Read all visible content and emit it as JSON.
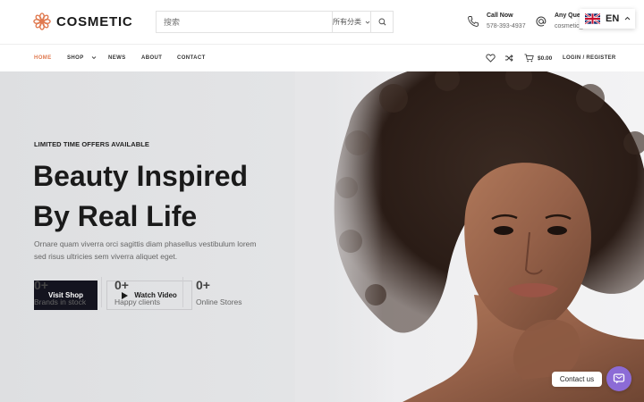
{
  "brand": {
    "name": "COSMETIC",
    "accent": "#e07a50",
    "dark": "#14141f"
  },
  "search": {
    "placeholder": "搜索",
    "category": "所有分类"
  },
  "contact": {
    "call_title": "Call Now",
    "call_value": "578-393-4937",
    "query_title": "Any Quer",
    "query_value": "cosmetic_"
  },
  "language": {
    "code": "EN",
    "flag": "uk-flag-icon"
  },
  "nav": {
    "items": [
      {
        "label": "HOME",
        "active": true
      },
      {
        "label": "SHOP",
        "active": false
      },
      {
        "label": "NEWS",
        "active": false
      },
      {
        "label": "ABOUT",
        "active": false
      },
      {
        "label": "CONTACT",
        "active": false
      }
    ],
    "cart_total": "$0.00",
    "login_label": "LOGIN / REGISTER"
  },
  "hero": {
    "eyebrow": "LIMITED TIME OFFERS AVAILABLE",
    "headline_line1": "Beauty Inspired",
    "headline_line2": "By Real Life",
    "subtext_line1": "Ornare quam viverra orci sagittis diam phasellus vestibulum lorem",
    "subtext_line2": "sed risus ultricies sem viverra aliquet eget.",
    "primary_button": "Visit Shop",
    "secondary_button": "Watch Video"
  },
  "stats": [
    {
      "value": "0+",
      "label": "Brands in stock"
    },
    {
      "value": "0+",
      "label": "Happy clients"
    },
    {
      "value": "0+",
      "label": "Online Stores"
    }
  ],
  "chat": {
    "label": "Contact us",
    "color": "#8c6bd6"
  }
}
